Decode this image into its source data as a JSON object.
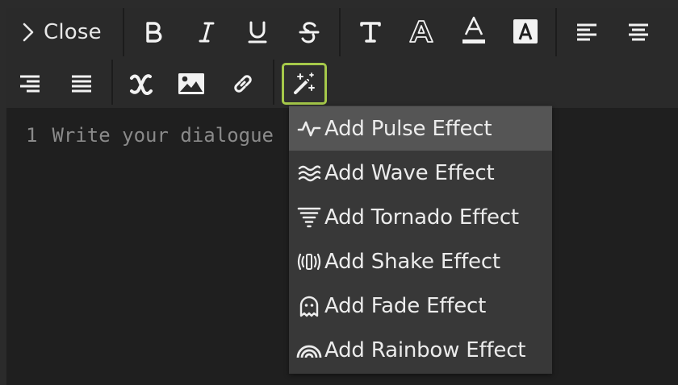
{
  "toolbar": {
    "close_label": "Close",
    "row1_buttons": [
      "bold-button",
      "italic-button",
      "underline-button",
      "strikethrough-button",
      "text-button",
      "outline-text-button",
      "text-color-button",
      "text-background-button",
      "align-left-button",
      "align-center-button"
    ],
    "row2_buttons": [
      "align-right-button",
      "justify-button",
      "variable-button",
      "image-button",
      "link-button",
      "effects-button"
    ],
    "active_button": "effects-button",
    "accent_color": "#a6c94a"
  },
  "editor": {
    "line_number": "1",
    "placeholder": "Write your dialogue"
  },
  "effects_menu": {
    "items": [
      {
        "label": "Add Pulse Effect",
        "icon": "pulse-icon",
        "highlighted": true
      },
      {
        "label": "Add Wave Effect",
        "icon": "wave-icon",
        "highlighted": false
      },
      {
        "label": "Add Tornado Effect",
        "icon": "tornado-icon",
        "highlighted": false
      },
      {
        "label": "Add Shake Effect",
        "icon": "shake-icon",
        "highlighted": false
      },
      {
        "label": "Add Fade Effect",
        "icon": "ghost-icon",
        "highlighted": false
      },
      {
        "label": "Add Rainbow Effect",
        "icon": "rainbow-icon",
        "highlighted": false
      }
    ]
  }
}
